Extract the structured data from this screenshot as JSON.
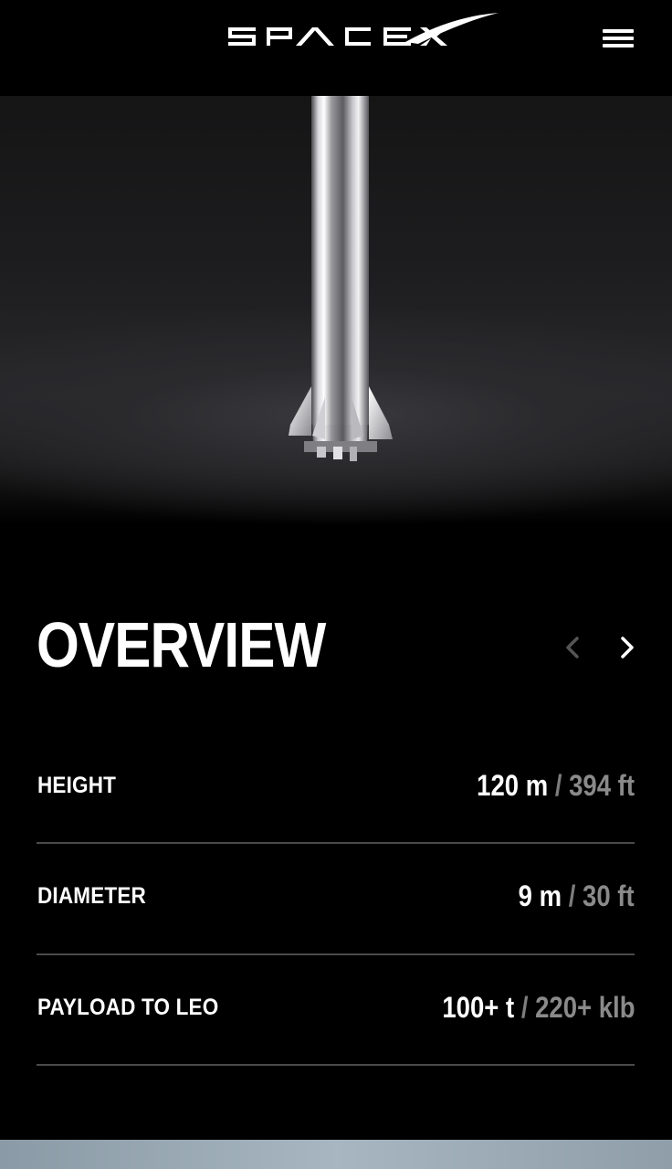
{
  "header": {
    "logo_text": "SPACEX",
    "logo_icon": "spacex-logo",
    "menu_icon": "hamburger-menu-icon"
  },
  "hero": {
    "image": "starship-rocket-image"
  },
  "section": {
    "title": "OVERVIEW",
    "prev_icon": "chevron-left-icon",
    "next_icon": "chevron-right-icon"
  },
  "specs": [
    {
      "label": "HEIGHT",
      "metric": "120 m",
      "sep": " / ",
      "imperial": "394 ft"
    },
    {
      "label": "DIAMETER",
      "metric": "9 m",
      "sep": " / ",
      "imperial": "30 ft"
    },
    {
      "label": "PAYLOAD TO LEO",
      "metric": "100+ t",
      "sep": " / ",
      "imperial": "220+ klb"
    }
  ],
  "colors": {
    "background": "#000000",
    "text": "#ffffff",
    "muted": "#8a8a8a",
    "divider": "#4a4a4a"
  }
}
